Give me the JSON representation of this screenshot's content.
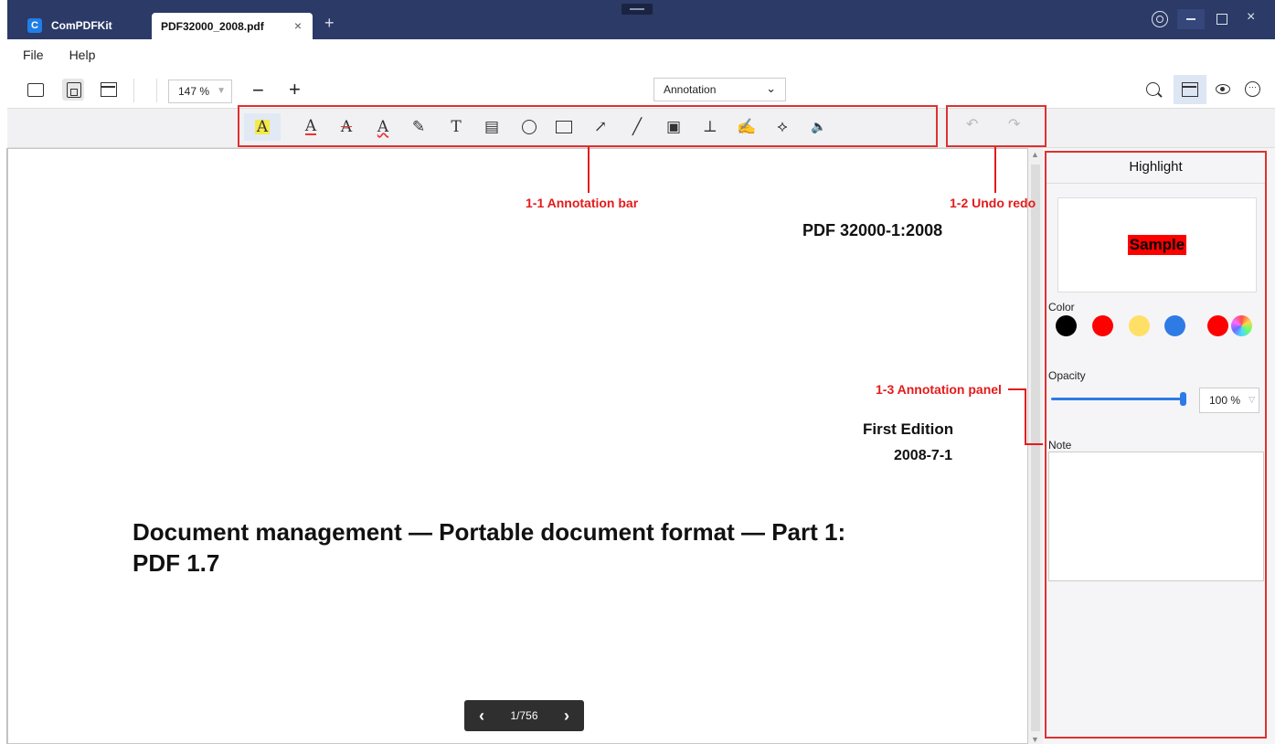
{
  "titlebar": {
    "app_name": "ComPDFKit",
    "logo_letter": "C",
    "doc_tab": "PDF32000_2008.pdf",
    "close_glyph": "×",
    "new_tab_glyph": "+",
    "close_window_glyph": "×"
  },
  "menu": {
    "items": [
      "File",
      "Help"
    ]
  },
  "toolbar": {
    "zoom": "147  %",
    "zoom_out": "−",
    "zoom_in": "+",
    "mode": "Annotation"
  },
  "annotation_tools": [
    {
      "name": "highlight",
      "glyph": "A"
    },
    {
      "name": "underline",
      "glyph": "A"
    },
    {
      "name": "strikeout",
      "glyph": "A"
    },
    {
      "name": "squiggly",
      "glyph": "A"
    },
    {
      "name": "freehand",
      "glyph": "✎"
    },
    {
      "name": "freetext",
      "glyph": "T"
    },
    {
      "name": "note",
      "glyph": "▤"
    },
    {
      "name": "circle",
      "glyph": ""
    },
    {
      "name": "square",
      "glyph": ""
    },
    {
      "name": "arrow",
      "glyph": "↗"
    },
    {
      "name": "line",
      "glyph": "╱"
    },
    {
      "name": "image",
      "glyph": "▣"
    },
    {
      "name": "stamp",
      "glyph": "⊥"
    },
    {
      "name": "signature",
      "glyph": "✍"
    },
    {
      "name": "link",
      "glyph": "⟡"
    },
    {
      "name": "sound",
      "glyph": "🔈"
    }
  ],
  "undo_redo": {
    "undo": "↶",
    "redo": "↷"
  },
  "document": {
    "standard_number": "PDF 32000-1:2008",
    "edition": "First Edition",
    "date": "2008-7-1",
    "title_line1": "Document management — Portable document format — Part 1:",
    "title_line2": "PDF 1.7"
  },
  "callouts": {
    "annotation_bar": "1-1 Annotation bar",
    "undo_redo": "1-2 Undo redo",
    "annotation_panel": "1-3 Annotation panel"
  },
  "pager": {
    "prev": "‹",
    "current": "1/756",
    "next": "›"
  },
  "panel": {
    "title": "Highlight",
    "sample": "Sample",
    "color_label": "Color",
    "colors": [
      "#000000",
      "#ff0000",
      "#ffe066",
      "#2e7be6",
      "#ff0000"
    ],
    "opacity_label": "Opacity",
    "opacity_value": "100  %",
    "opacity_level": 1.0,
    "note_label": "Note"
  }
}
